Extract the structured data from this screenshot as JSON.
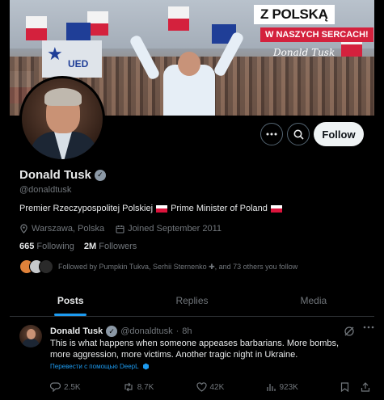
{
  "banner": {
    "slogan_line1": "Z POLSKĄ",
    "slogan_line2": "W NASZYCH SERCACH!",
    "signature": "Donald Tusk",
    "sign_text": "UED"
  },
  "actions": {
    "more_icon": "more-horizontal-icon",
    "search_icon": "search-icon",
    "follow_label": "Follow"
  },
  "profile": {
    "name": "Donald Tusk",
    "handle": "@donaldtusk",
    "bio_part1": "Premier Rzeczypospolitej Polskiej",
    "bio_part2": "Prime Minister of Poland",
    "location": "Warszawa, Polska",
    "joined": "Joined September 2011",
    "following_count": "665",
    "following_label": "Following",
    "followers_count": "2M",
    "followers_label": "Followers",
    "followed_by": "Followed by Pumpkin Tukva, Serhii Sternenko ✚, and 73 others you follow"
  },
  "tabs": [
    {
      "label": "Posts",
      "active": true
    },
    {
      "label": "Replies",
      "active": false
    },
    {
      "label": "Media",
      "active": false
    }
  ],
  "tweet": {
    "author": "Donald Tusk",
    "handle": "@donaldtusk",
    "time": "8h",
    "text": "This is what happens when someone appeases barbarians. More bombs, more aggression, more victims. Another tragic night in Ukraine.",
    "translate": "Перевести с помощью DeepL",
    "replies": "2.5K",
    "reposts": "8.7K",
    "likes": "42K",
    "views": "923K"
  },
  "colors": {
    "accent": "#1d9bf0",
    "polish_red": "#dc143c",
    "verified_gray": "#8b98a5"
  }
}
